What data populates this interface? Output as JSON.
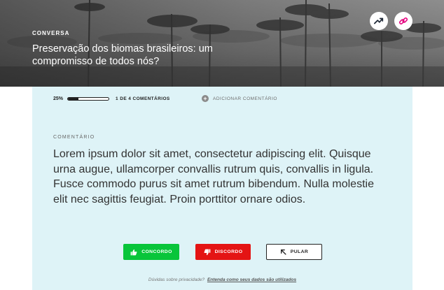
{
  "hero": {
    "eyebrow": "CONVERSA",
    "title": "Preservação dos biomas brasileiros: um compromisso de todos nós?",
    "trend_icon": "trending-up-icon",
    "link_icon": "link-icon",
    "link_color": "#e5007e"
  },
  "progress": {
    "percent_label": "25%",
    "value": 0.25,
    "count_label": "1 DE 4 COMENTÁRIOS",
    "add_comment_label": "ADICIONAR COMENTÁRIO"
  },
  "comment": {
    "label": "COMENTÁRIO",
    "text": "Lorem ipsum dolor sit amet, consectetur adipiscing elit. Quisque urna augue, ullamcorper convallis rutrum quis, convallis in ligula. Fusce commodo purus sit amet rutrum bibendum. Nulla molestie elit nec sagittis feugiat. Proin porttitor ornare odios."
  },
  "actions": {
    "agree_label": "CONCORDO",
    "disagree_label": "DISCORDO",
    "skip_label": "PULAR",
    "agree_color": "#08c53a",
    "disagree_color": "#e41414"
  },
  "privacy": {
    "question": "Dúvidas sobre privacidade?",
    "link_label": "Entenda como seus dados são utilizados"
  },
  "colors": {
    "panel_background": "#def3f7"
  }
}
